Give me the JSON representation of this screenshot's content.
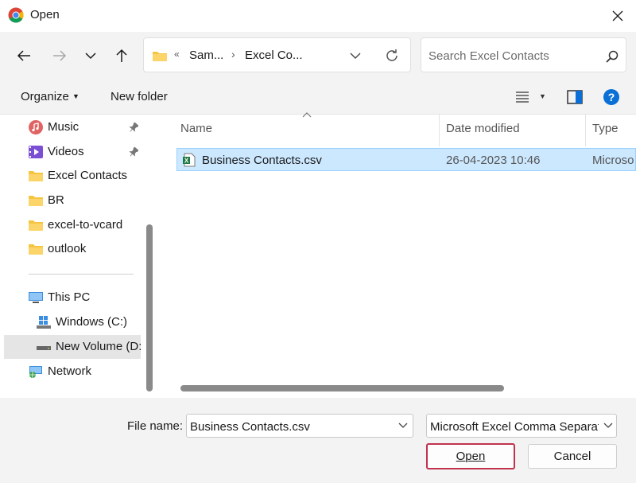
{
  "window": {
    "title": "Open"
  },
  "nav_bar": {
    "address_segments": [
      "Sam...",
      "Excel Co..."
    ],
    "address_prefix": "«",
    "search_placeholder": "Search Excel Contacts"
  },
  "toolbar": {
    "organize_label": "Organize",
    "new_folder_label": "New folder"
  },
  "sidebar": {
    "items": [
      {
        "label": "Music",
        "icon": "music-icon",
        "pinned": true
      },
      {
        "label": "Videos",
        "icon": "videos-icon",
        "pinned": true
      },
      {
        "label": "Excel Contacts",
        "icon": "folder-icon"
      },
      {
        "label": "BR",
        "icon": "folder-icon"
      },
      {
        "label": "excel-to-vcard",
        "icon": "folder-icon"
      },
      {
        "label": "outlook",
        "icon": "folder-icon"
      },
      {
        "label": "This PC",
        "icon": "pc-icon"
      },
      {
        "label": "Windows (C:)",
        "icon": "windows-drive-icon"
      },
      {
        "label": "New Volume (D:",
        "icon": "drive-icon",
        "selected": true
      },
      {
        "label": "Network",
        "icon": "network-icon"
      }
    ]
  },
  "file_list": {
    "columns": [
      "Name",
      "Date modified",
      "Type"
    ],
    "rows": [
      {
        "name": "Business Contacts.csv",
        "date_modified": "26-04-2023 10:46",
        "type": "Microso",
        "selected": true
      }
    ]
  },
  "footer": {
    "file_name_label": "File name:",
    "file_name_value": "Business Contacts.csv",
    "file_type_value": "Microsoft Excel Comma Separated",
    "open_label": "Open",
    "cancel_label": "Cancel"
  },
  "colors": {
    "selection_bg": "#cce8ff",
    "open_button_border": "#c0334d",
    "help_blue": "#0a6fd6",
    "folder_yellow": "#f5c542"
  }
}
